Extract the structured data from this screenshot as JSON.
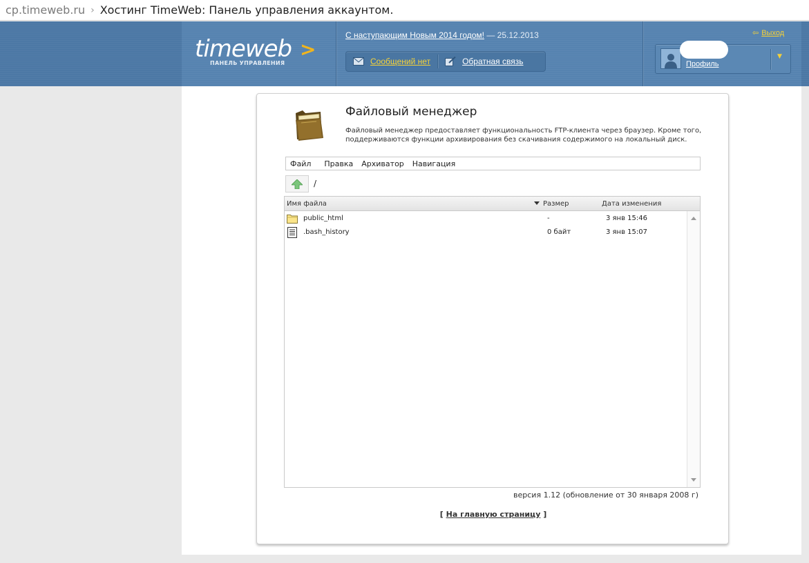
{
  "browser": {
    "domain": "cp.timeweb.ru",
    "separator": "›",
    "title": "Хостинг TimeWeb: Панель управления аккаунтом."
  },
  "header": {
    "logo_text": "timeweb",
    "logo_chevron": ">",
    "logo_sub": "ПАНЕЛЬ УПРАВЛЕНИЯ",
    "news_link": "С наступающим Новым 2014 годом!",
    "news_date": "— 25.12.2013",
    "messages_label": "Сообщений нет",
    "feedback_label": "Обратная связь",
    "logout_label": "Выход",
    "profile_label": "Профиль",
    "accent_color": "#f2b51c"
  },
  "app": {
    "title": "Файловый менеджер",
    "description": "Файловый менеджер предоставляет функциональность FTP-клиента через браузер. Кроме того, поддерживаются функции архивирования без скачивания содержимого на локальный диск.",
    "menu": [
      "Файл",
      "Правка",
      "Архиватор",
      "Навигация"
    ],
    "path": "/"
  },
  "filelist": {
    "columns": {
      "name": "Имя файла",
      "size": "Размер",
      "date": "Дата изменения"
    },
    "rows": [
      {
        "name": "public_html",
        "size": "-",
        "date": "3 янв 15:46",
        "icon": "folder-icon"
      },
      {
        "name": ".bash_history",
        "size": "0 байт",
        "date": "3 янв 15:07",
        "icon": "text-file-icon"
      }
    ]
  },
  "footer": {
    "version": "версия 1.12 (обновление от 30 января 2008 г)",
    "home_open": "[",
    "home_link": "На главную страницу",
    "home_close": "]"
  }
}
